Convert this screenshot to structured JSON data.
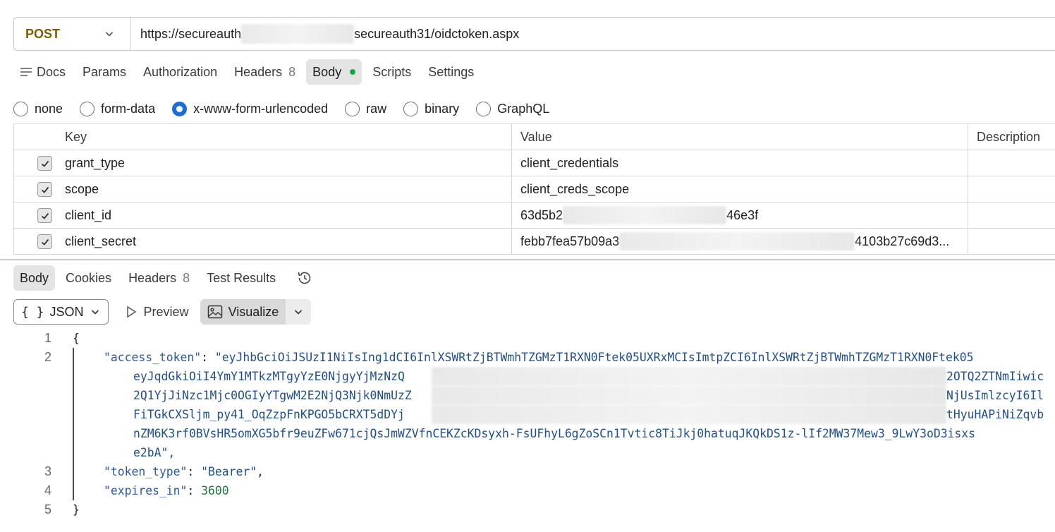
{
  "request": {
    "method": "POST",
    "url_prefix": "https://secureauth",
    "url_suffix": "secureauth31/oidctoken.aspx"
  },
  "request_tabs": [
    {
      "label": "Docs"
    },
    {
      "label": "Params"
    },
    {
      "label": "Authorization"
    },
    {
      "label": "Headers",
      "count": "8"
    },
    {
      "label": "Body",
      "active": true
    },
    {
      "label": "Scripts"
    },
    {
      "label": "Settings"
    }
  ],
  "body_types": [
    "none",
    "form-data",
    "x-www-form-urlencoded",
    "raw",
    "binary",
    "GraphQL"
  ],
  "body_type_selected": "x-www-form-urlencoded",
  "table": {
    "headers": [
      "Key",
      "Value",
      "Description"
    ],
    "rows": [
      {
        "key": "grant_type",
        "value": "client_credentials",
        "checked": true
      },
      {
        "key": "scope",
        "value": "client_creds_scope",
        "checked": true
      },
      {
        "key": "client_id",
        "value_prefix": "63d5b2",
        "value_suffix": "46e3f",
        "checked": true
      },
      {
        "key": "client_secret",
        "value_prefix": "febb7fea57b09a3",
        "value_suffix": "4103b27c69d3...",
        "checked": true
      }
    ]
  },
  "response_tabs": [
    {
      "label": "Body",
      "active": true
    },
    {
      "label": "Cookies"
    },
    {
      "label": "Headers",
      "count": "8"
    },
    {
      "label": "Test Results"
    }
  ],
  "format": {
    "select": "JSON",
    "brace": "{ }",
    "preview": "Preview",
    "visualize": "Visualize"
  },
  "code": {
    "line_numbers": [
      "1",
      "2",
      "3",
      "4",
      "5"
    ],
    "open_brace": "{",
    "close_brace": "}",
    "access_token_key": "\"access_token\"",
    "access_token_lines": [
      "\"eyJhbGciOiJSUzI1NiIsIng1dCI6InlXSWRtZjBTWmhTZGMzT1RXN0Ftek05UXRxMCIsImtpZCI6InlXSWRtZjBTWmhTZGMzT1RXN0Ftek05",
      "eyJqdGkiOiI4YmY1MTkzMTgyYzE0NjgyYjMzNzQ",
      "2Q1YjJiNzc1Mjc0OGIyYTgwM2E2NjQ3Njk0NmUzZ",
      "FiTGkCXSljm_py41_OqZzpFnKPGO5bCRXT5dDYj",
      "nZM6K3rf0BVsHR5omXG5bfr9euZFw671cjQsJmWZVfnCEKZcKDsyxh-FsUFhyL6gZoSCn1Tvtic8TiJkj0hatuqJKQkDS1z-lIf2MW37Mew3_9LwY3oD3isxs",
      "e2bA\","
    ],
    "access_token_line_tails": [
      "",
      "2OTQ2ZTNmIiwic",
      "NjUsImlzcyI6Il",
      "tHyuHAPiNiZqvb",
      "",
      ""
    ],
    "token_type_key": "\"token_type\"",
    "token_type_value": "\"Bearer\"",
    "expires_in_key": "\"expires_in\"",
    "expires_in_value": "3600"
  }
}
